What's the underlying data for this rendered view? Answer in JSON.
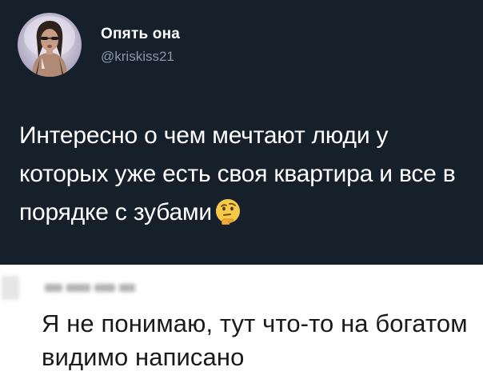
{
  "tweet": {
    "author": {
      "display_name": "Опять она",
      "handle": "@kriskiss21"
    },
    "text": "Интересно о чем мечтают люди у которых уже есть своя квартира и все в порядке с зубами",
    "emoji": "thinking-face"
  },
  "comment": {
    "text": "Я не понимаю, тут что-то на богатом видимо написано"
  },
  "colors": {
    "tweet_background": "#15202b",
    "tweet_text": "#ffffff",
    "handle_text": "#8b98a5",
    "comment_background": "#ffffff",
    "comment_text": "#1a1a1a"
  }
}
